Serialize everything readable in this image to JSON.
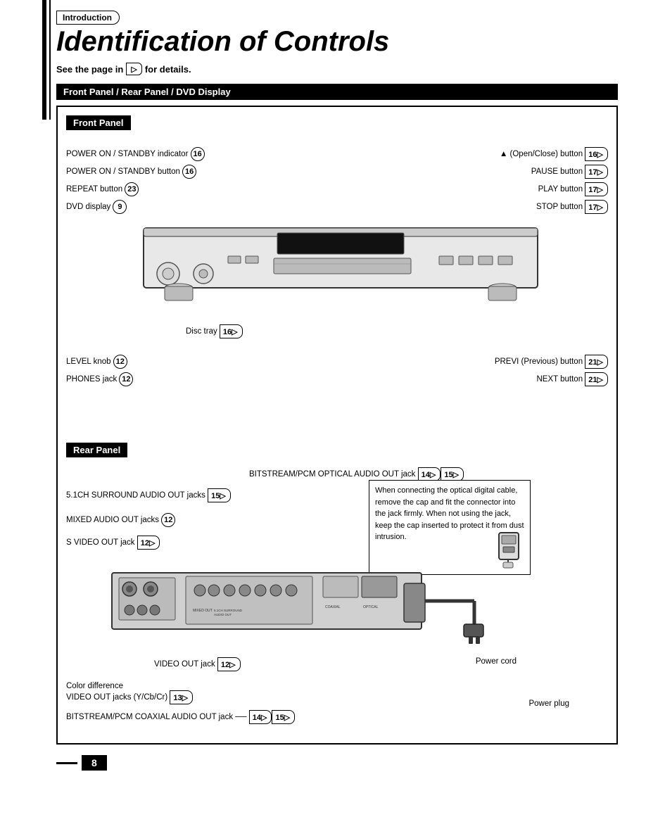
{
  "breadcrumb": "Introduction",
  "title": "Identification of Controls",
  "see_page_text": "See the page in",
  "see_page_suffix": "for details.",
  "section_header": "Front Panel / Rear Panel / DVD Display",
  "front_panel_label": "Front Panel",
  "rear_panel_label": "Rear Panel",
  "page_number": "8",
  "front_annotations": [
    {
      "label": "POWER ON / STANDBY indicator",
      "page": "16",
      "arrow": false
    },
    {
      "label": "POWER ON / STANDBY button",
      "page": "16",
      "arrow": false
    },
    {
      "label": "REPEAT button",
      "page": "23",
      "arrow": false
    },
    {
      "label": "DVD display",
      "page": "9",
      "arrow": false
    },
    {
      "label": "Disc tray",
      "page": "16",
      "arrow": true
    },
    {
      "label": "LEVEL knob",
      "page": "12",
      "arrow": false
    },
    {
      "label": "PHONES jack",
      "page": "12",
      "arrow": false
    },
    {
      "label": "▲ (Open/Close) button",
      "page": "16",
      "arrow": true
    },
    {
      "label": "PAUSE button",
      "page": "17",
      "arrow": true
    },
    {
      "label": "PLAY button",
      "page": "17",
      "arrow": true
    },
    {
      "label": "STOP button",
      "page": "17",
      "arrow": true
    },
    {
      "label": "PREVI (Previous) button",
      "page": "21",
      "arrow": true
    },
    {
      "label": "NEXT button",
      "page": "21",
      "arrow": true
    }
  ],
  "rear_annotations": [
    {
      "label": "5.1CH SURROUND AUDIO OUT jacks",
      "page": "15",
      "arrow": false
    },
    {
      "label": "MIXED AUDIO OUT jacks",
      "page": "12",
      "arrow": false
    },
    {
      "label": "S VIDEO OUT jack",
      "page": "12",
      "arrow": false
    },
    {
      "label": "BITSTREAM/PCM OPTICAL AUDIO OUT jack",
      "pages": [
        "14",
        "15"
      ],
      "arrow": false
    },
    {
      "label": "VIDEO OUT jack",
      "page": "12",
      "arrow": false
    },
    {
      "label": "Color difference\nVIDEO OUT jacks (Y/Cb/Cr)",
      "page": "13",
      "arrow": false
    },
    {
      "label": "BITSTREAM/PCM COAXIAL AUDIO OUT jack",
      "pages": [
        "14",
        "15"
      ],
      "arrow": false
    },
    {
      "label": "Power cord",
      "arrow": false
    },
    {
      "label": "Power plug",
      "arrow": false
    }
  ],
  "callout_text": "When connecting the optical digital cable, remove the cap and fit the connector into the jack firmly. When not using the jack, keep the cap inserted to protect it from dust intrusion."
}
